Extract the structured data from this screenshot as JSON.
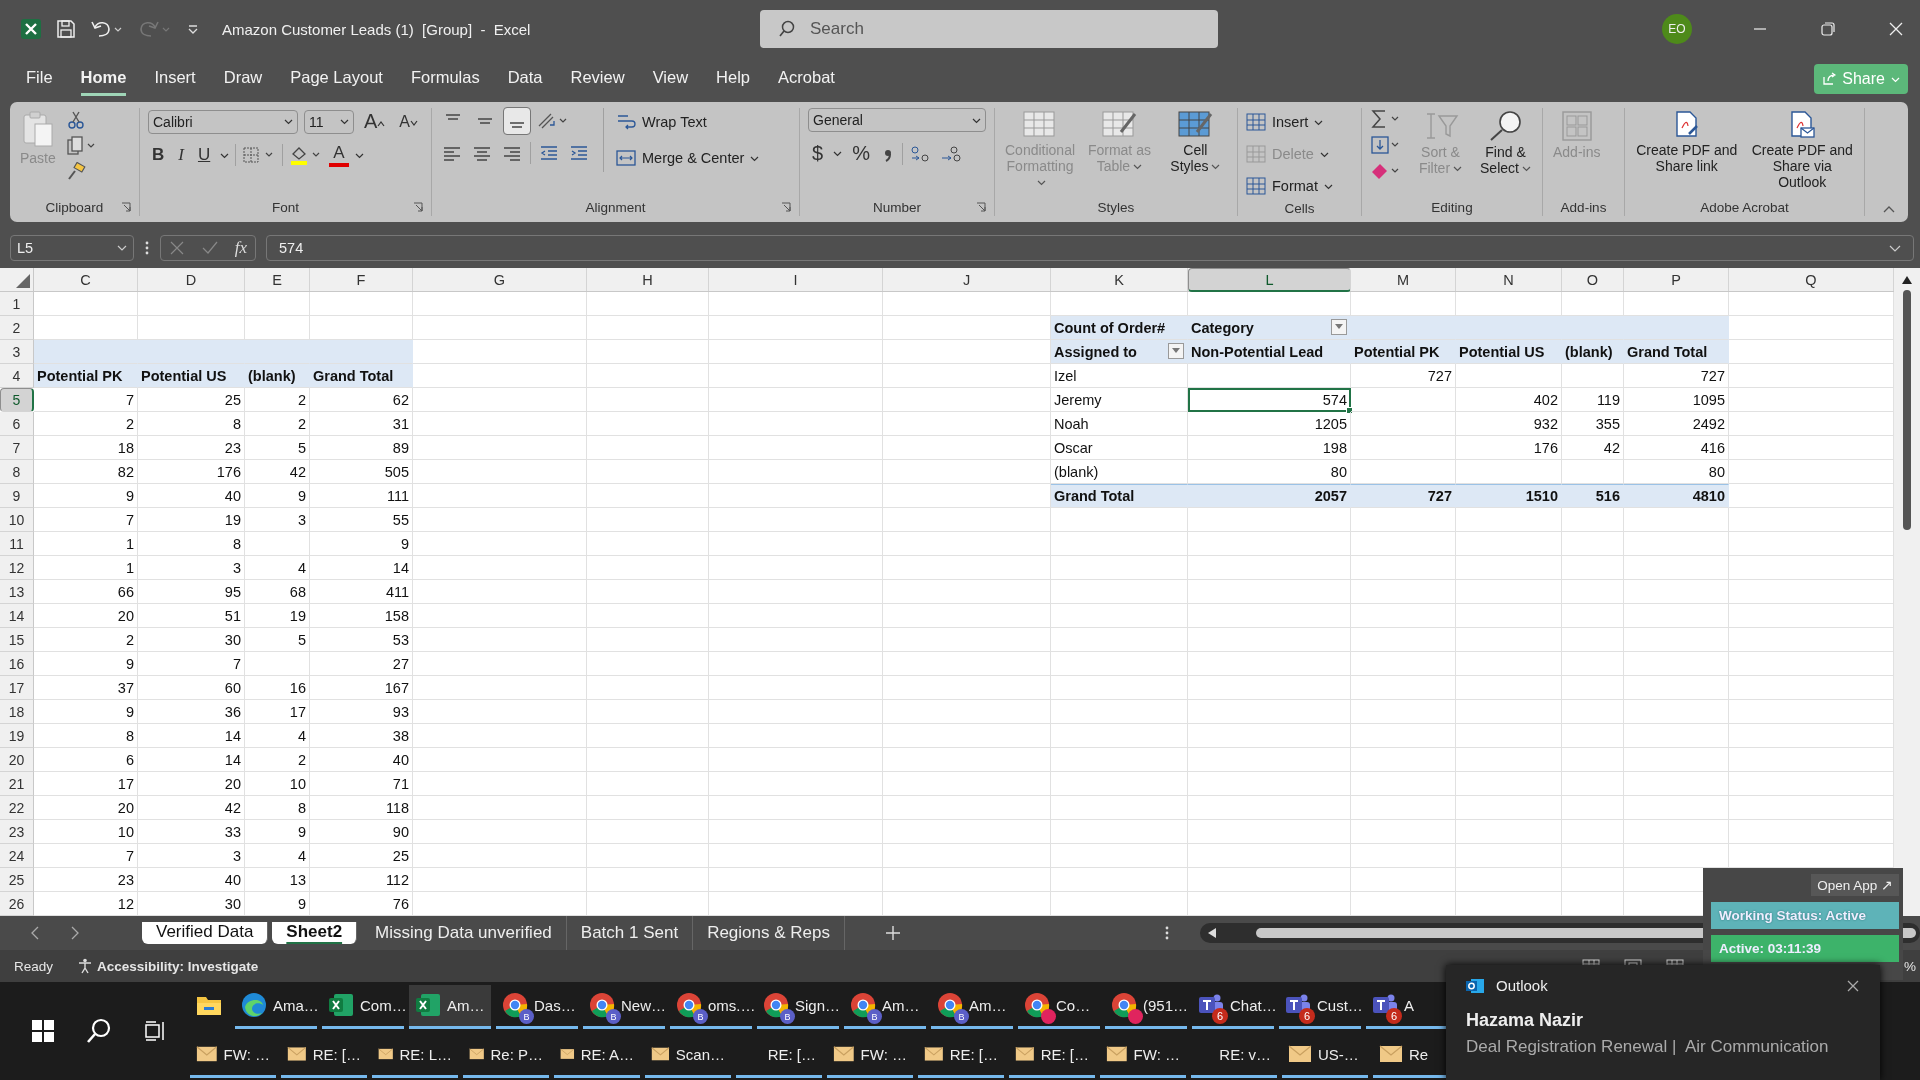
{
  "window": {
    "title": "Amazon Customer Leads (1)  [Group]  -  Excel",
    "search": {
      "placeholder": "Search"
    },
    "avatar": "EO"
  },
  "menu": [
    {
      "label": "File",
      "selected": false
    },
    {
      "label": "Home",
      "selected": true
    },
    {
      "label": "Insert",
      "selected": false
    },
    {
      "label": "Draw",
      "selected": false
    },
    {
      "label": "Page Layout",
      "selected": false
    },
    {
      "label": "Formulas",
      "selected": false
    },
    {
      "label": "Data",
      "selected": false
    },
    {
      "label": "Review",
      "selected": false
    },
    {
      "label": "View",
      "selected": false
    },
    {
      "label": "Help",
      "selected": false
    },
    {
      "label": "Acrobat",
      "selected": false
    }
  ],
  "share": "Share",
  "ribbon": {
    "clipboard": {
      "label": "Clipboard",
      "paste": {
        "label": "Paste",
        "disabled": true
      }
    },
    "font": {
      "label": "Font",
      "family": "Calibri",
      "size": "11",
      "grow": "A",
      "shrink": "A",
      "bold": "B",
      "italic": "I",
      "underline": "U",
      "font_color": "A"
    },
    "alignment": {
      "label": "Alignment",
      "vertical": [
        {
          "selected": false
        },
        {
          "selected": false
        },
        {
          "selected": true
        }
      ],
      "wrap_text": "Wrap Text",
      "merge": "Merge & Center"
    },
    "number": {
      "label": "Number",
      "format": "General",
      "currency": "$",
      "percent": "%"
    },
    "styles": {
      "label": "Styles",
      "buttons": [
        {
          "label": "Conditional Formatting",
          "disabled": true
        },
        {
          "label": "Format as Table",
          "disabled": true
        },
        {
          "label": "Cell Styles",
          "disabled": false
        }
      ]
    },
    "cells": {
      "label": "Cells",
      "buttons": [
        {
          "label": "Insert",
          "disabled": false
        },
        {
          "label": "Delete",
          "disabled": true
        },
        {
          "label": "Format",
          "disabled": false
        }
      ]
    },
    "editing": {
      "label": "Editing",
      "buttons": [
        {
          "label": "Sort & Filter",
          "disabled": true
        },
        {
          "label": "Find & Select",
          "disabled": false
        }
      ]
    },
    "addins": {
      "label": "Add-ins",
      "button": {
        "label": "Add-ins",
        "disabled": true
      }
    },
    "acrobat": {
      "label": "Adobe Acrobat",
      "buttons": [
        "Create PDF and Share link",
        "Create PDF and Share via Outlook"
      ]
    }
  },
  "formula_bar": {
    "name_box": "L5",
    "fx": "fx",
    "value": "574"
  },
  "sheet": {
    "columns": [
      {
        "label": "C",
        "selected": false
      },
      {
        "label": "D",
        "selected": false
      },
      {
        "label": "E",
        "selected": false
      },
      {
        "label": "F",
        "selected": false
      },
      {
        "label": "G",
        "selected": false
      },
      {
        "label": "H",
        "selected": false
      },
      {
        "label": "I",
        "selected": false
      },
      {
        "label": "J",
        "selected": false
      },
      {
        "label": "K",
        "selected": false
      },
      {
        "label": "L",
        "selected": true
      },
      {
        "label": "M",
        "selected": false
      },
      {
        "label": "N",
        "selected": false
      },
      {
        "label": "O",
        "selected": false
      },
      {
        "label": "P",
        "selected": false
      },
      {
        "label": "Q",
        "selected": false
      }
    ],
    "rows": [
      {
        "number": "1",
        "selected": false
      },
      {
        "number": "2",
        "selected": false,
        "pivot_header": true,
        "cells": {
          "K": "Count of Order#",
          "L": {
            "text": "Category",
            "filter": true
          }
        }
      },
      {
        "number": "3",
        "selected": false,
        "left_header": true,
        "pivot_header": true,
        "cells": {
          "K": {
            "text": "Assigned to",
            "filter": true
          },
          "L": "Non-Potential Lead",
          "M": "Potential PK",
          "N": "Potential US",
          "O": "(blank)",
          "P": "Grand Total"
        }
      },
      {
        "number": "4",
        "selected": false,
        "left_header": true,
        "cells": {
          "C": "Potential PK",
          "D": "Potential US",
          "E": "(blank)",
          "F": "Grand Total",
          "K": "Izel",
          "M": "727",
          "P": "727"
        }
      },
      {
        "number": "5",
        "selected": true,
        "cells": {
          "C": "7",
          "D": "25",
          "E": "2",
          "F": "62",
          "K": "Jeremy",
          "L": {
            "text": "574",
            "selected": true
          },
          "N": "402",
          "O": "119",
          "P": "1095"
        }
      },
      {
        "number": "6",
        "selected": false,
        "cells": {
          "C": "2",
          "D": "8",
          "E": "2",
          "F": "31",
          "K": "Noah",
          "L": "1205",
          "N": "932",
          "O": "355",
          "P": "2492"
        }
      },
      {
        "number": "7",
        "selected": false,
        "cells": {
          "C": "18",
          "D": "23",
          "E": "5",
          "F": "89",
          "K": "Oscar",
          "L": "198",
          "N": "176",
          "O": "42",
          "P": "416"
        }
      },
      {
        "number": "8",
        "selected": false,
        "cells": {
          "C": "82",
          "D": "176",
          "E": "42",
          "F": "505",
          "K": "(blank)",
          "L": "80",
          "P": "80"
        }
      },
      {
        "number": "9",
        "selected": false,
        "pivot_total": true,
        "cells": {
          "C": "9",
          "D": "40",
          "E": "9",
          "F": "111",
          "K": "Grand Total",
          "L": "2057",
          "M": "727",
          "N": "1510",
          "O": "516",
          "P": "4810"
        }
      },
      {
        "number": "10",
        "selected": false,
        "cells": {
          "C": "7",
          "D": "19",
          "E": "3",
          "F": "55"
        }
      },
      {
        "number": "11",
        "selected": false,
        "cells": {
          "C": "1",
          "D": "8",
          "F": "9"
        }
      },
      {
        "number": "12",
        "selected": false,
        "cells": {
          "C": "1",
          "D": "3",
          "E": "4",
          "F": "14"
        }
      },
      {
        "number": "13",
        "selected": false,
        "cells": {
          "C": "66",
          "D": "95",
          "E": "68",
          "F": "411"
        }
      },
      {
        "number": "14",
        "selected": false,
        "cells": {
          "C": "20",
          "D": "51",
          "E": "19",
          "F": "158"
        }
      },
      {
        "number": "15",
        "selected": false,
        "cells": {
          "C": "2",
          "D": "30",
          "E": "5",
          "F": "53"
        }
      },
      {
        "number": "16",
        "selected": false,
        "cells": {
          "C": "9",
          "D": "7",
          "F": "27"
        }
      },
      {
        "number": "17",
        "selected": false,
        "cells": {
          "C": "37",
          "D": "60",
          "E": "16",
          "F": "167"
        }
      },
      {
        "number": "18",
        "selected": false,
        "cells": {
          "C": "9",
          "D": "36",
          "E": "17",
          "F": "93"
        }
      },
      {
        "number": "19",
        "selected": false,
        "cells": {
          "C": "8",
          "D": "14",
          "E": "4",
          "F": "38"
        }
      },
      {
        "number": "20",
        "selected": false,
        "cells": {
          "C": "6",
          "D": "14",
          "E": "2",
          "F": "40"
        }
      },
      {
        "number": "21",
        "selected": false,
        "cells": {
          "C": "17",
          "D": "20",
          "E": "10",
          "F": "71"
        }
      },
      {
        "number": "22",
        "selected": false,
        "cells": {
          "C": "20",
          "D": "42",
          "E": "8",
          "F": "118"
        }
      },
      {
        "number": "23",
        "selected": false,
        "cells": {
          "C": "10",
          "D": "33",
          "E": "9",
          "F": "90"
        }
      },
      {
        "number": "24",
        "selected": false,
        "cells": {
          "C": "7",
          "D": "3",
          "E": "4",
          "F": "25"
        }
      },
      {
        "number": "25",
        "selected": false,
        "cells": {
          "C": "23",
          "D": "40",
          "E": "13",
          "F": "112"
        }
      },
      {
        "number": "26",
        "selected": false,
        "cells": {
          "C": "12",
          "D": "30",
          "E": "9",
          "F": "76"
        }
      }
    ]
  },
  "sheet_tabs": [
    {
      "label": "Verified Data",
      "selected": true,
      "active": false
    },
    {
      "label": "Sheet2",
      "selected": true,
      "active": true
    },
    {
      "label": "Missing Data unverified",
      "selected": false,
      "active": false
    },
    {
      "label": "Batch 1 Sent",
      "selected": false,
      "active": false
    },
    {
      "label": "Regions & Reps",
      "selected": false,
      "active": false
    }
  ],
  "status_bar": {
    "status": "Ready",
    "accessibility": "Accessibility: Investigate",
    "zoom": "%"
  },
  "widget": {
    "open_app": "Open App ↗",
    "working_status": "Working Status: Active",
    "active_time": "Active: 03:11:39"
  },
  "taskbar": {
    "apps": [
      {
        "kind": "explorer",
        "running": false,
        "selected": false
      },
      {
        "kind": "edge",
        "label": "Ama…",
        "running": true,
        "selected": false
      },
      {
        "kind": "excel",
        "label": "Com…",
        "running": true,
        "selected": false
      },
      {
        "kind": "excel",
        "label": "Am…",
        "running": true,
        "selected": true
      },
      {
        "kind": "chrome",
        "label": "Das…",
        "badge": "B",
        "color": "#5b5fc7",
        "running": true,
        "selected": false
      },
      {
        "kind": "chrome",
        "label": "New…",
        "badge": "B",
        "color": "#5b5fc7",
        "running": true,
        "selected": false
      },
      {
        "kind": "chrome",
        "label": "oms.…",
        "badge": "B",
        "color": "#5b5fc7",
        "running": true,
        "selected": false
      },
      {
        "kind": "chrome",
        "label": "Sign…",
        "badge": "B",
        "color": "#5b5fc7",
        "running": true,
        "selected": false
      },
      {
        "kind": "chrome",
        "label": "Am…",
        "badge": "B",
        "color": "#5b5fc7",
        "running": true,
        "selected": false
      },
      {
        "kind": "chrome",
        "label": "Am…",
        "badge": "B",
        "color": "#5b5fc7",
        "running": true,
        "selected": false
      },
      {
        "kind": "chrome",
        "label": "Co…",
        "color": "#e0245e",
        "running": true,
        "selected": false
      },
      {
        "kind": "chrome",
        "label": "(951…",
        "color": "#e0245e",
        "running": true,
        "selected": false
      },
      {
        "kind": "teams",
        "label": "Chat…",
        "badge": "6",
        "running": true,
        "selected": false
      },
      {
        "kind": "teams",
        "label": "Cust…",
        "badge": "6",
        "running": true,
        "selected": false
      },
      {
        "kind": "teams",
        "label": "A",
        "badge": "6",
        "running": true,
        "selected": false
      }
    ],
    "windows": [
      {
        "kind": "mail",
        "label": "FW: …"
      },
      {
        "kind": "mail",
        "label": "RE: […"
      },
      {
        "kind": "mail",
        "label": "RE: L…"
      },
      {
        "kind": "mail",
        "label": "Re: P…"
      },
      {
        "kind": "mail",
        "label": "RE: A…"
      },
      {
        "kind": "mail",
        "label": "Scan…"
      },
      {
        "kind": "plain",
        "label": "RE: […"
      },
      {
        "kind": "mail",
        "label": "FW: …"
      },
      {
        "kind": "mail",
        "label": "RE: […"
      },
      {
        "kind": "mail",
        "label": "RE: […"
      },
      {
        "kind": "mail",
        "label": "FW: …"
      },
      {
        "kind": "plain",
        "label": "RE: v…"
      },
      {
        "kind": "mail",
        "label": "US-…"
      },
      {
        "kind": "mail",
        "label": "Re"
      }
    ]
  },
  "notification": {
    "app": "Outlook",
    "sender": "Hazama Nazir",
    "message": "Deal Registration Renewal |  Air Communication"
  }
}
